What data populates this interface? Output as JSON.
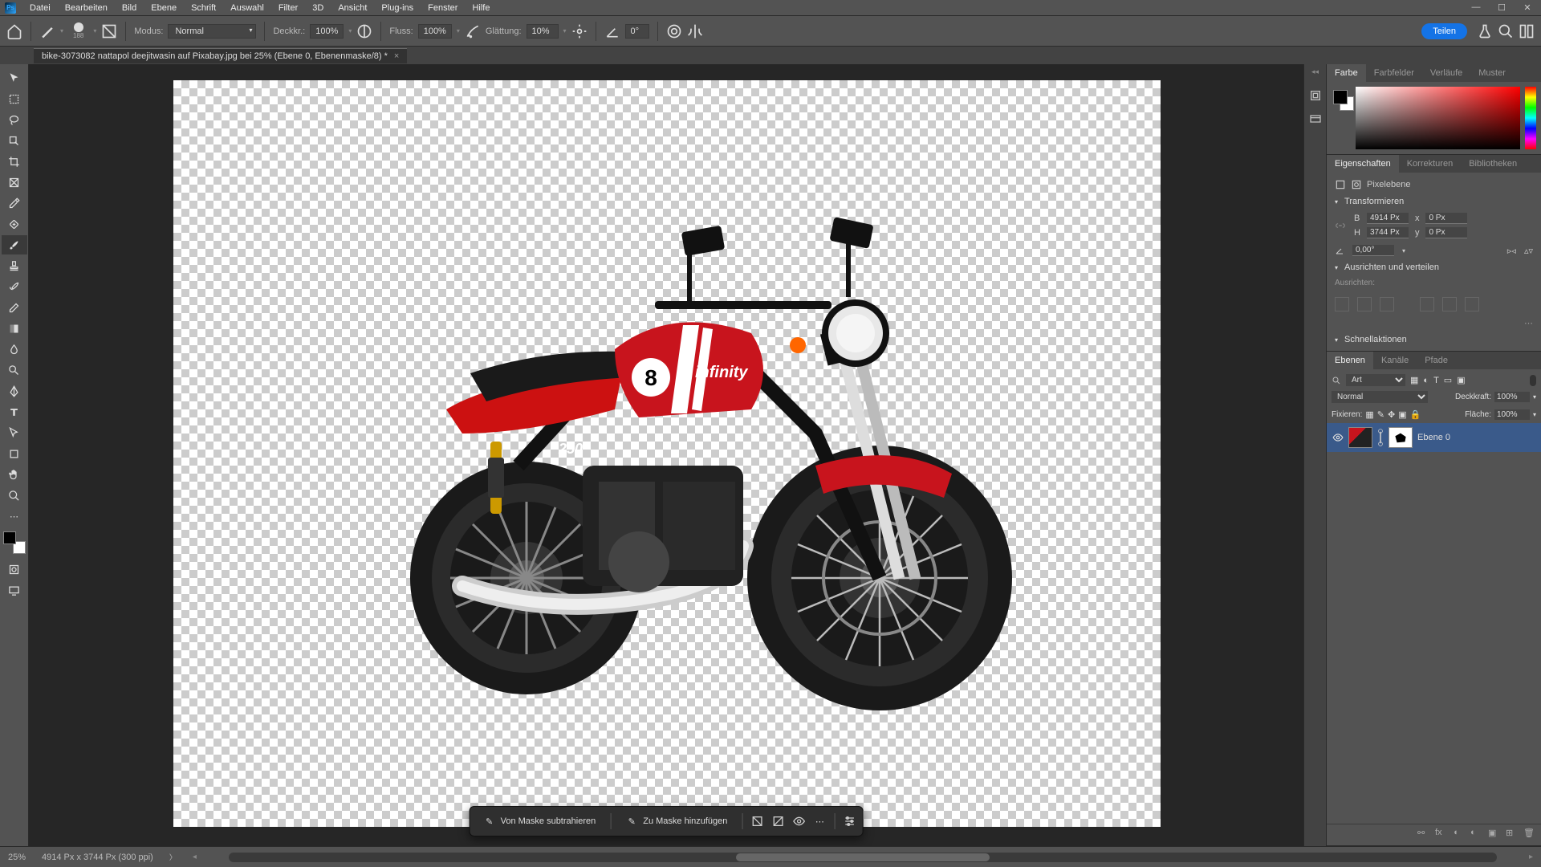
{
  "app": {
    "logo": "Ps"
  },
  "menu": [
    "Datei",
    "Bearbeiten",
    "Bild",
    "Ebene",
    "Schrift",
    "Auswahl",
    "Filter",
    "3D",
    "Ansicht",
    "Plug-ins",
    "Fenster",
    "Hilfe"
  ],
  "options": {
    "brush_size": "188",
    "mode_label": "Modus:",
    "mode_value": "Normal",
    "opacity_label": "Deckkr.:",
    "opacity_value": "100%",
    "flow_label": "Fluss:",
    "flow_value": "100%",
    "smooth_label": "Glättung:",
    "smooth_value": "10%",
    "angle_value": "0°",
    "share": "Teilen"
  },
  "document": {
    "tab_title": "bike-3073082 nattapol deejitwasin auf Pixabay.jpg bei 25% (Ebene 0, Ebenenmaske/8) *"
  },
  "ctx": {
    "subtract": "Von Maske subtrahieren",
    "add": "Zu Maske hinzufügen"
  },
  "panels": {
    "color_tabs": [
      "Farbe",
      "Farbfelder",
      "Verläufe",
      "Muster"
    ],
    "props_tabs": [
      "Eigenschaften",
      "Korrekturen",
      "Bibliotheken"
    ],
    "layers_tabs": [
      "Ebenen",
      "Kanäle",
      "Pfade"
    ]
  },
  "properties": {
    "type": "Pixelebene",
    "transform_label": "Transformieren",
    "w_label": "B",
    "w_value": "4914 Px",
    "h_label": "H",
    "h_value": "3744 Px",
    "x_label": "x",
    "x_value": "0 Px",
    "y_label": "y",
    "y_value": "0 Px",
    "angle": "0,00°",
    "align_label": "Ausrichten und verteilen",
    "align_sub": "Ausrichten:",
    "quick_label": "Schnellaktionen"
  },
  "layers": {
    "filter_kind": "Art",
    "blend_mode": "Normal",
    "opacity_label": "Deckkraft:",
    "opacity_value": "100%",
    "lock_label": "Fixieren:",
    "fill_label": "Fläche:",
    "fill_value": "100%",
    "layer0_name": "Ebene 0"
  },
  "status": {
    "zoom": "25%",
    "doc_info": "4914 Px x 3744 Px (300 ppi)"
  }
}
